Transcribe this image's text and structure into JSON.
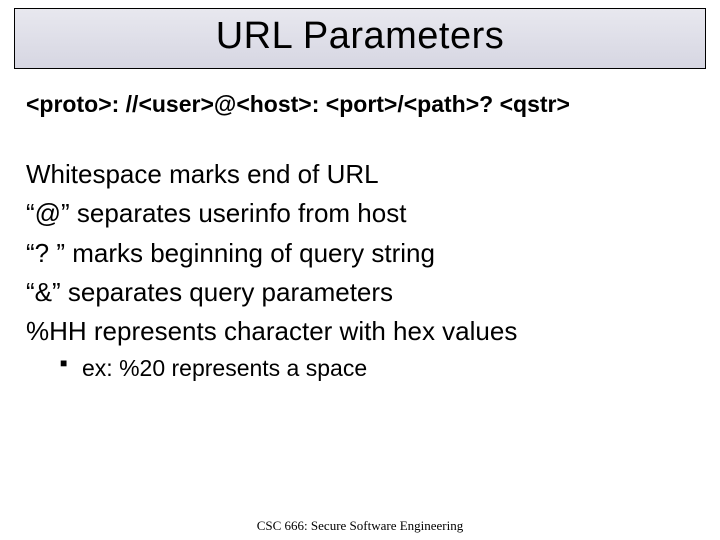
{
  "title": "URL Parameters",
  "syntax": "<proto>: //<user>@<host>: <port>/<path>? <qstr>",
  "lines": [
    "Whitespace marks end of URL",
    "“@” separates userinfo from host",
    "“? ” marks beginning of query string",
    "“&” separates query parameters",
    "%HH represents character with hex values"
  ],
  "sub": {
    "ex": "ex: %20 represents a space"
  },
  "footer": "CSC 666: Secure Software Engineering"
}
